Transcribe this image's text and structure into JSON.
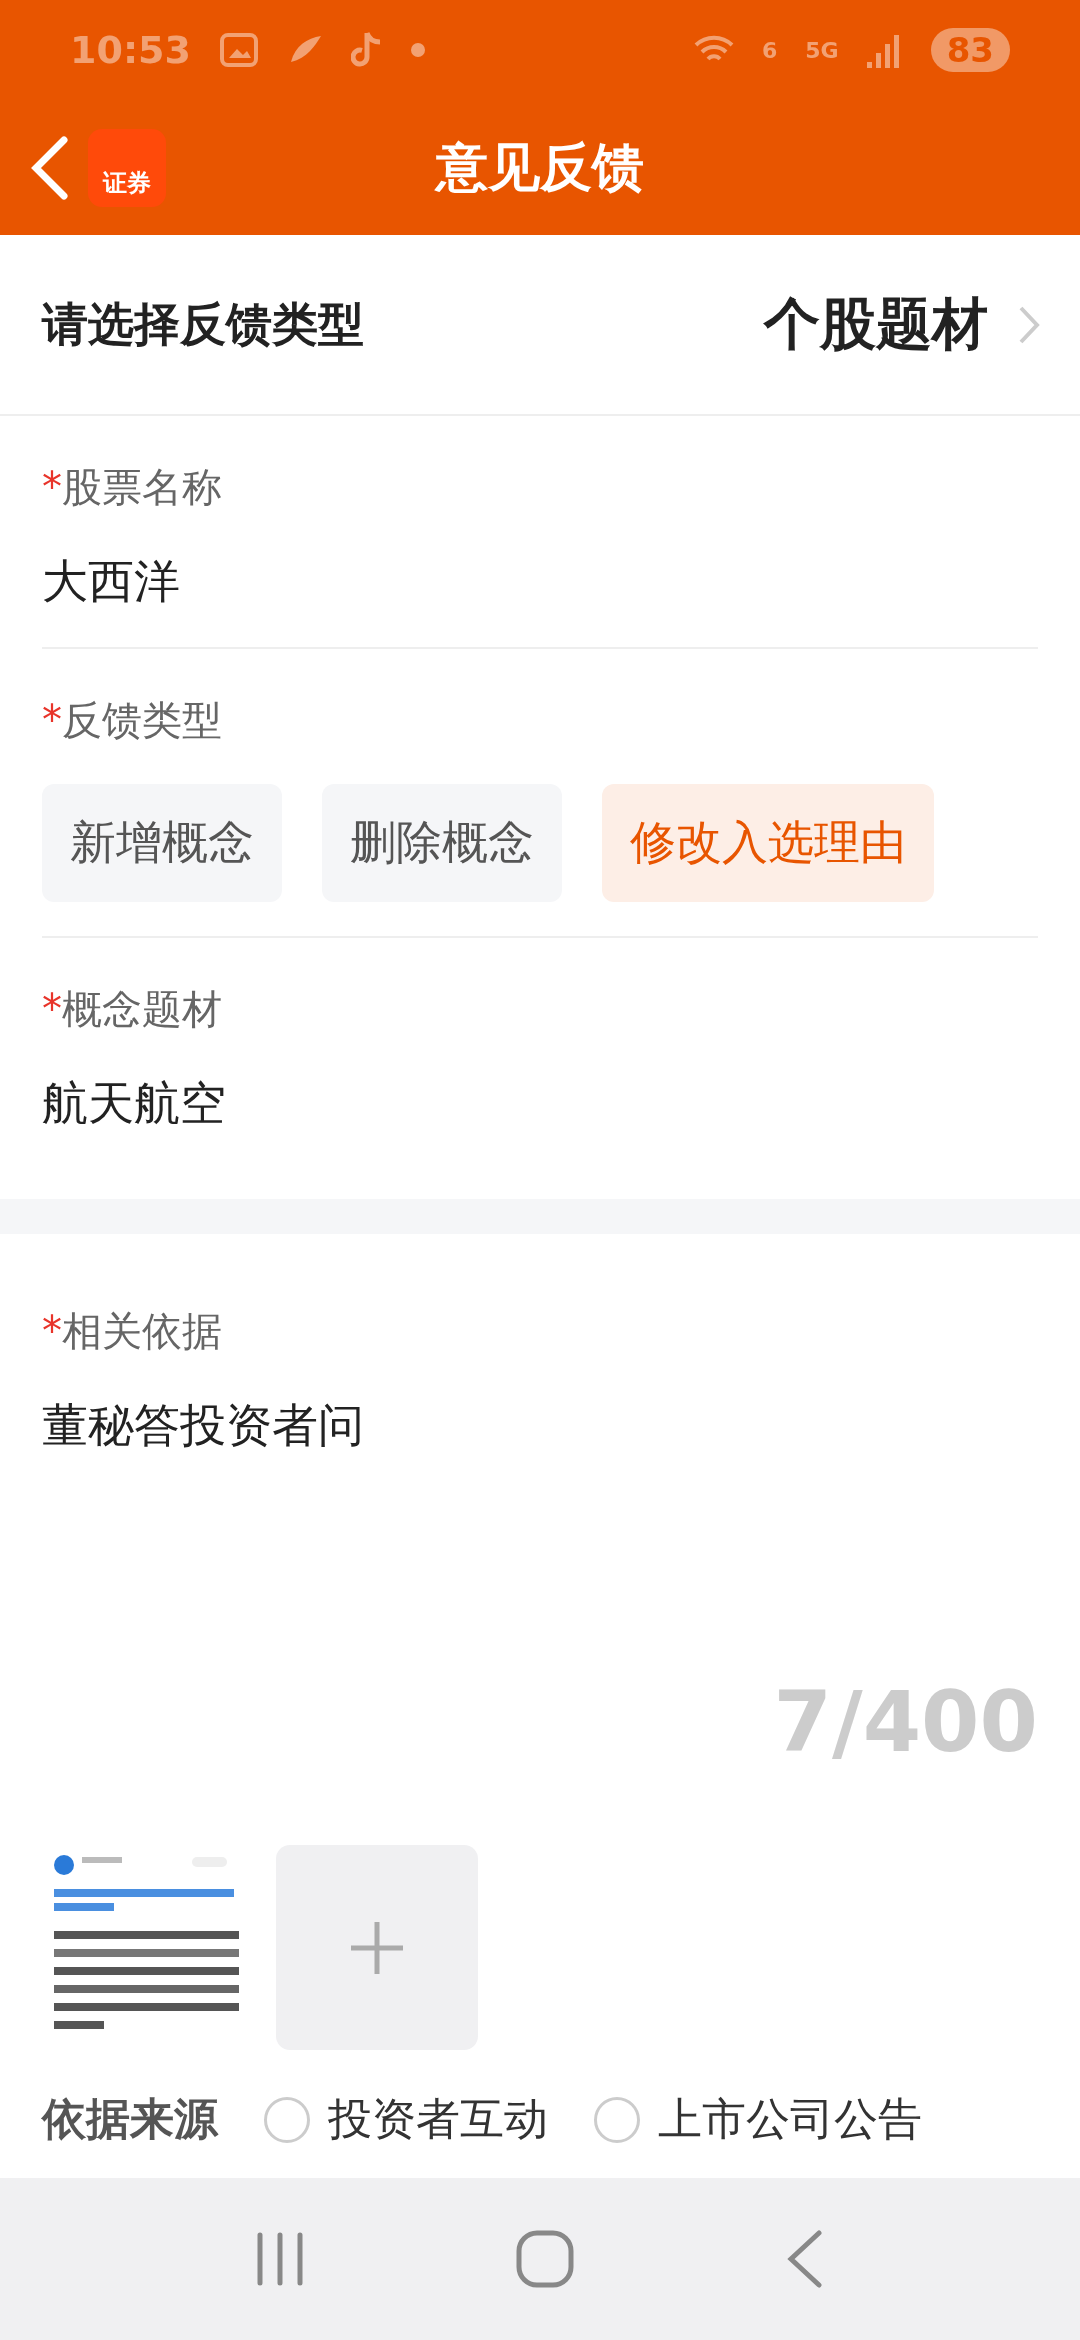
{
  "status_bar": {
    "time": "10:53",
    "network": "5G",
    "wifi_badge": "6",
    "battery": "83"
  },
  "header": {
    "title": "意见反馈",
    "logo_text": "证券"
  },
  "type_row": {
    "label": "请选择反馈类型",
    "value": "个股题材"
  },
  "fields": [
    {
      "kind": "text",
      "label": "股票名称",
      "required_mark": "*",
      "value": "大西洋"
    },
    {
      "kind": "chips",
      "label": "反馈类型",
      "required_mark": "*",
      "options": [
        {
          "label": "新增概念",
          "selected": false
        },
        {
          "label": "删除概念",
          "selected": false
        },
        {
          "label": "修改入选理由",
          "selected": true
        }
      ]
    },
    {
      "kind": "text",
      "label": "概念题材",
      "required_mark": "*",
      "value": "航天航空"
    }
  ],
  "basis": {
    "label": "相关依据",
    "required_mark": "*",
    "value": "董秘答投资者问",
    "counter": "7/400"
  },
  "source": {
    "label": "依据来源",
    "options": [
      {
        "label": "投资者互动",
        "selected": false
      },
      {
        "label": "上市公司公告",
        "selected": false
      }
    ]
  }
}
